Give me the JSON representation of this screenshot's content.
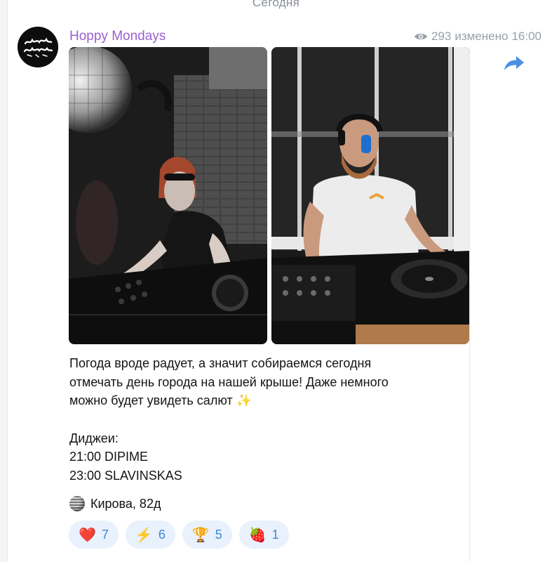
{
  "date_separator": "Сегодня",
  "channel": {
    "name": "Hoppy Mondays",
    "avatar_text": "HOPPY MNDYS"
  },
  "post": {
    "views": "293",
    "edited_label": "изменено",
    "time": "16:00",
    "text_lines": [
      "Погода вроде радует, а значит собираемся сегодня",
      "отмечать день города на нашей крыше! Даже немного",
      "можно будет увидеть салют"
    ],
    "sparkle": "✨",
    "djs_title": "Диджеи:",
    "dj_lines": [
      "21:00 DIPIME",
      "23:00 SLAVINSKAS"
    ],
    "location": "Кирова, 82д"
  },
  "reactions": [
    {
      "emoji": "❤️",
      "count": "7"
    },
    {
      "emoji": "⚡",
      "count": "6"
    },
    {
      "emoji": "🏆",
      "count": "5"
    },
    {
      "emoji": "🍓",
      "count": "1"
    }
  ],
  "colors": {
    "channel_name": "#9a5fd0",
    "reaction_bg": "#e8f1fc",
    "reaction_text": "#3d8ad8",
    "meta_text": "#9aa0a8"
  }
}
